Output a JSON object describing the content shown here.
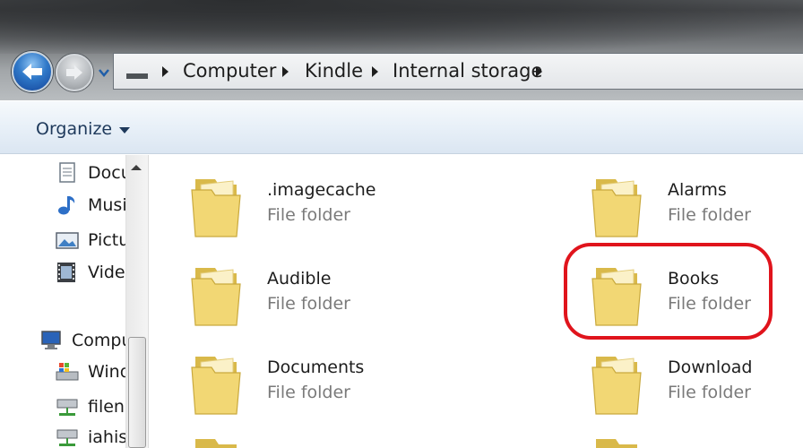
{
  "breadcrumbs": [
    "Computer",
    "Kindle",
    "Internal storage"
  ],
  "toolbar": {
    "organize_label": "Organize"
  },
  "nav_pane": {
    "items": [
      {
        "label": "Documents",
        "icon": "document-icon"
      },
      {
        "label": "Music",
        "icon": "music-icon"
      },
      {
        "label": "Pictures",
        "icon": "picture-icon"
      },
      {
        "label": "Videos",
        "icon": "video-icon"
      },
      {
        "label": "Computer",
        "icon": "computer-icon"
      },
      {
        "label": "Windows",
        "icon": "drive-icon"
      },
      {
        "label": "filen",
        "icon": "network-drive-icon"
      },
      {
        "label": "iahis",
        "icon": "network-drive-icon"
      }
    ]
  },
  "folders": [
    {
      "name": ".imagecache",
      "type": "File folder"
    },
    {
      "name": "Alarms",
      "type": "File folder"
    },
    {
      "name": "Audible",
      "type": "File folder"
    },
    {
      "name": "Books",
      "type": "File folder",
      "highlighted": true
    },
    {
      "name": "Documents",
      "type": "File folder"
    },
    {
      "name": "Download",
      "type": "File folder"
    }
  ],
  "colors": {
    "highlight": "#e0141c",
    "back_button": "#2f78c8",
    "folder": "#f2d774"
  }
}
